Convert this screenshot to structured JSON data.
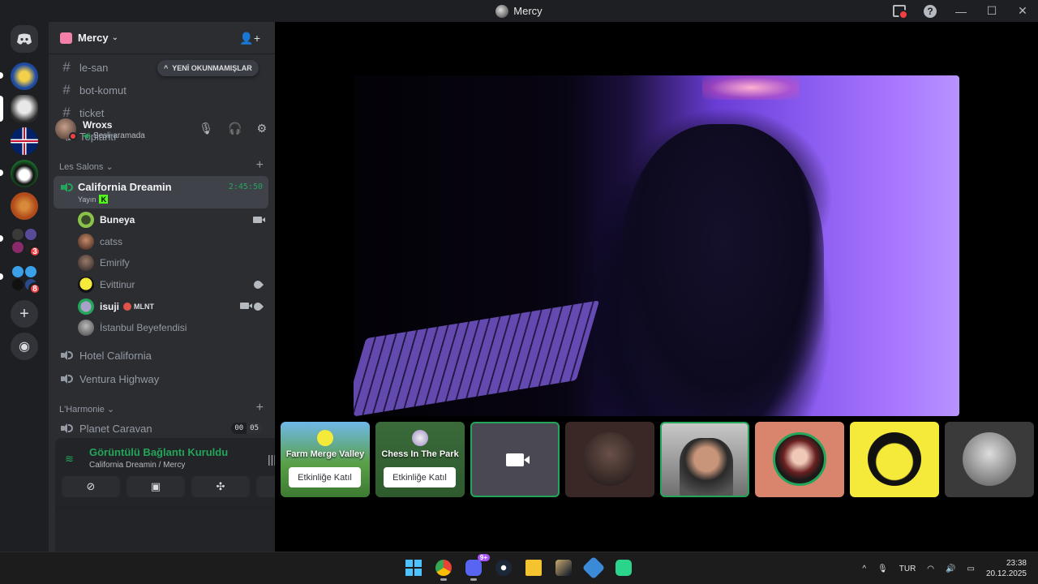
{
  "window": {
    "title": "Mercy"
  },
  "server": {
    "name": "Mercy"
  },
  "unread_pill": "YENİ OKUNMAMIŞLAR",
  "text_channels": [
    {
      "name": "le-san"
    },
    {
      "name": "bot-komut"
    },
    {
      "name": "ticket"
    }
  ],
  "voice_top": {
    "name": "Toplantı"
  },
  "categories": {
    "salons": "Les Salons",
    "harmonie": "L'Harmonie"
  },
  "active_channel": {
    "name": "California Dreamin",
    "status": "Yayın",
    "timer": "2:45:50"
  },
  "voice_users": [
    {
      "name": "Buneya",
      "icons": [
        "camera"
      ],
      "color": "#8bc34a"
    },
    {
      "name": "catss",
      "icons": [],
      "color": "#6b3b2f"
    },
    {
      "name": "Emirify",
      "icons": [],
      "color": "#5a4a46"
    },
    {
      "name": "Evittinur",
      "icons": [
        "rocket"
      ],
      "color": "#f5e93a"
    },
    {
      "name": "isuji",
      "tag": "MLNT",
      "icons": [
        "camera",
        "rocket"
      ],
      "color": "#a8a2c8"
    },
    {
      "name": "İstanbul Beyefendisi",
      "icons": [],
      "color": "#8a8a8a"
    }
  ],
  "other_voice": [
    {
      "name": "Hotel California"
    },
    {
      "name": "Ventura Highway"
    }
  ],
  "harmonie_channel": {
    "name": "Planet Caravan",
    "count_a": "00",
    "count_b": "05"
  },
  "voice_panel": {
    "status": "Görüntülü Bağlantı Kuruldu",
    "location": "California Dreamin / Mercy"
  },
  "user": {
    "name": "Wroxs",
    "status": "Sesli aramada"
  },
  "guild_badges": {
    "g6": "3",
    "g7": "8"
  },
  "activities": [
    {
      "title": "Farm Merge Valley",
      "button": "Etkinliğe Katıl"
    },
    {
      "title": "Chess In The Park",
      "button": "Etkinliğe Katıl"
    }
  ],
  "taskbar": {
    "discord_badge": "9+",
    "lang": "TUR",
    "time": "23:38",
    "date": "20.12.2025"
  },
  "colors": {
    "accent_green": "#23a55a",
    "sidebar": "#2b2d31",
    "rail": "#1e1f22",
    "stage": "#000000"
  }
}
